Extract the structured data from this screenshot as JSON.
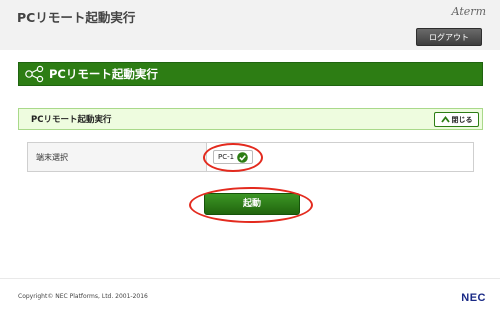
{
  "header": {
    "title": "PCリモート起動実行",
    "brand": "Aterm",
    "logout_label": "ログアウト"
  },
  "banner": {
    "title": "PCリモート起動実行",
    "icon": "network-nodes-icon"
  },
  "section": {
    "title": "PCリモート起動実行",
    "close_label": "閉じる",
    "close_icon": "caret-up-icon"
  },
  "form": {
    "label": "端末選択",
    "selected_pc": "PC-1",
    "badge_icon": "check-circle-icon"
  },
  "actions": {
    "start_label": "起動"
  },
  "footer": {
    "copyright": "Copyright© NEC Platforms, Ltd. 2001-2016",
    "logo": "NEC"
  },
  "colors": {
    "accent_green": "#2d7d14",
    "section_bg": "#eefcdf",
    "highlight_red": "#e32a1e",
    "logo_navy": "#1a2a86"
  }
}
